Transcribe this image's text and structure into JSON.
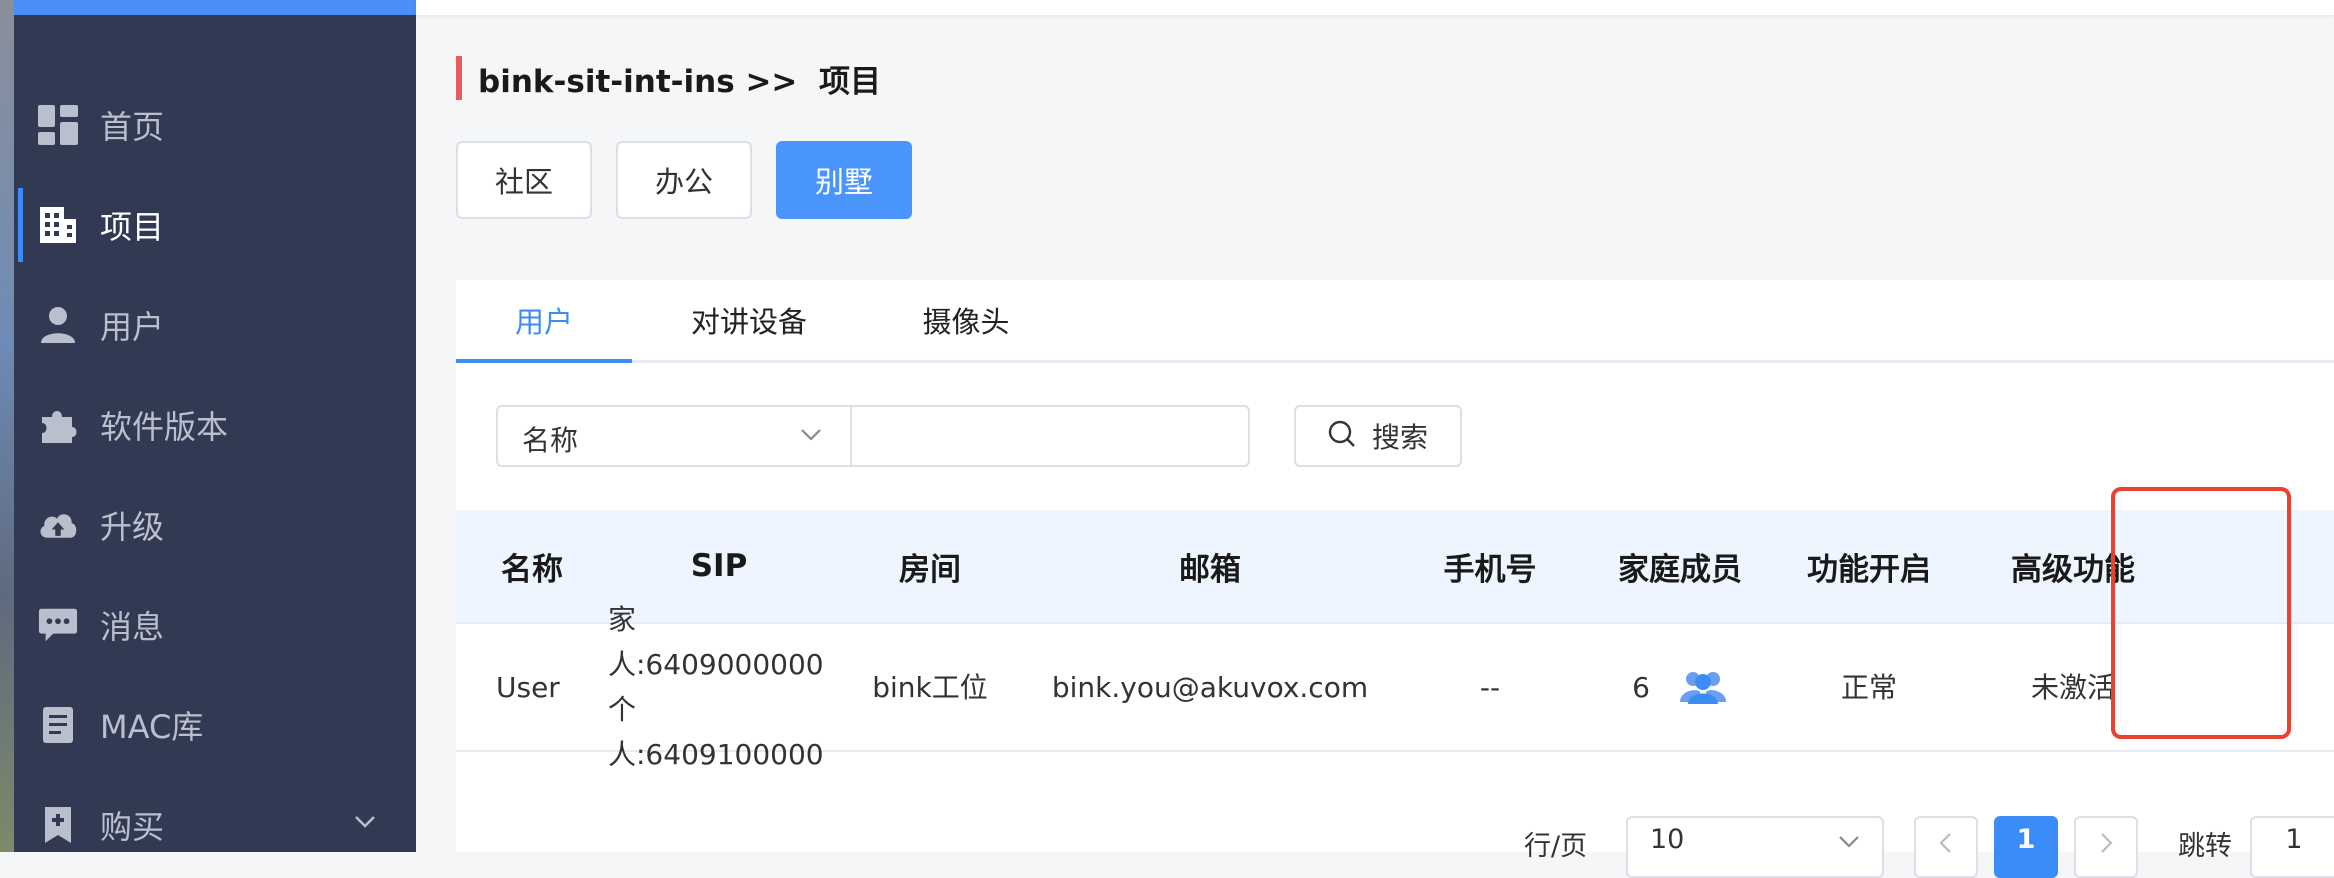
{
  "sidebar": {
    "items": [
      {
        "label": "首页",
        "icon": "dashboard-icon"
      },
      {
        "label": "项目",
        "icon": "building-icon",
        "active": true
      },
      {
        "label": "用户",
        "icon": "user-icon"
      },
      {
        "label": "软件版本",
        "icon": "puzzle-icon"
      },
      {
        "label": "升级",
        "icon": "cloud-upload-icon"
      },
      {
        "label": "消息",
        "icon": "message-icon"
      },
      {
        "label": "MAC库",
        "icon": "document-icon"
      },
      {
        "label": "购买",
        "icon": "bookmark-icon",
        "expandable": true
      }
    ]
  },
  "breadcrumb": {
    "text": "bink-sit-int-ins >>  项目"
  },
  "project_types": [
    {
      "label": "社区"
    },
    {
      "label": "办公"
    },
    {
      "label": "别墅",
      "active": true
    }
  ],
  "tabs": [
    {
      "label": "用户",
      "active": true
    },
    {
      "label": "对讲设备"
    },
    {
      "label": "摄像头"
    }
  ],
  "search": {
    "field_select": "名称",
    "input_value": "",
    "button_label": "搜索"
  },
  "table": {
    "headers": [
      "名称",
      "SIP",
      "房间",
      "邮箱",
      "手机号",
      "家庭成员",
      "功能开启",
      "高级功能"
    ],
    "rows": [
      {
        "name": "User",
        "sip_family": "家人:6409000000",
        "sip_personal": "个人:6409100000",
        "room": "bink工位",
        "email": "bink.you@akuvox.com",
        "phone": "--",
        "family_members": "6",
        "feature_status": "正常",
        "advanced": "未激活"
      }
    ]
  },
  "pagination": {
    "rows_label": "行/页",
    "rows_value": "10",
    "current_page": "1",
    "jump_label": "跳转",
    "jump_value": "1"
  },
  "colors": {
    "sidebar_bg": "#313a52",
    "accent": "#3c8cf8",
    "highlight_box": "#e8432e",
    "breadcrumb_bar": "#e85d5d"
  }
}
